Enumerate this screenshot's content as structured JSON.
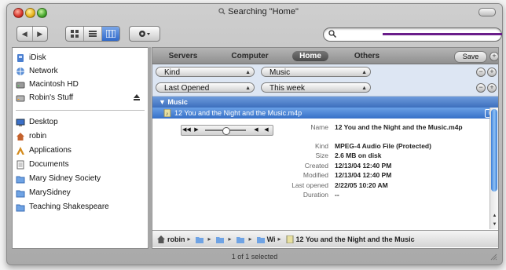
{
  "window": {
    "title": "Searching \"Home\"",
    "accent_color": "#3670c7"
  },
  "toolbar": {
    "nav": {
      "back_icon": "arrow-left-icon",
      "forward_icon": "arrow-right-icon"
    },
    "views": [
      "icon-view-icon",
      "list-view-icon",
      "column-view-icon"
    ],
    "selected_view": "column",
    "action_icon": "gear-icon",
    "search": {
      "value": "",
      "placeholder": ""
    }
  },
  "sidebar": {
    "devices": [
      {
        "label": "iDisk",
        "icon": "idisk-icon"
      },
      {
        "label": "Network",
        "icon": "network-icon"
      },
      {
        "label": "Macintosh HD",
        "icon": "hard-disk-icon"
      },
      {
        "label": "Robin's Stuff",
        "icon": "disk-icon",
        "ejectable": true
      }
    ],
    "places": [
      {
        "label": "Desktop",
        "icon": "desktop-icon"
      },
      {
        "label": "robin",
        "icon": "home-icon"
      },
      {
        "label": "Applications",
        "icon": "applications-icon"
      },
      {
        "label": "Documents",
        "icon": "documents-folder-icon"
      },
      {
        "label": "Mary Sidney Society",
        "icon": "folder-icon"
      },
      {
        "label": "MarySidney",
        "icon": "folder-icon"
      },
      {
        "label": "Teaching Shakespeare",
        "icon": "folder-icon"
      }
    ]
  },
  "scopes": {
    "items": [
      "Servers",
      "Computer",
      "Home",
      "Others"
    ],
    "selected": "Home",
    "save_label": "Save"
  },
  "criteria": [
    {
      "attribute": "Kind",
      "value": "Music"
    },
    {
      "attribute": "Last Opened",
      "value": "This week"
    }
  ],
  "results": {
    "group": "▼ Music",
    "file": "12 You and the Night and the Music.m4p"
  },
  "details": [
    {
      "key": "Name",
      "value": "12 You and the Night and the Music.m4p"
    },
    {
      "key": "Kind",
      "value": "MPEG-4 Audio File (Protected)"
    },
    {
      "key": "Size",
      "value": "2.6 MB on disk"
    },
    {
      "key": "Created",
      "value": "12/13/04 12:40 PM"
    },
    {
      "key": "Modified",
      "value": "12/13/04 12:40 PM"
    },
    {
      "key": "Last opened",
      "value": "2/22/05 10:20 AM"
    },
    {
      "key": "Duration",
      "value": "--"
    }
  ],
  "path_bar": {
    "segments": [
      "robin",
      "",
      "",
      "",
      "Wi",
      "12 You and the Night and the Music"
    ]
  },
  "status": "1 of 1 selected"
}
